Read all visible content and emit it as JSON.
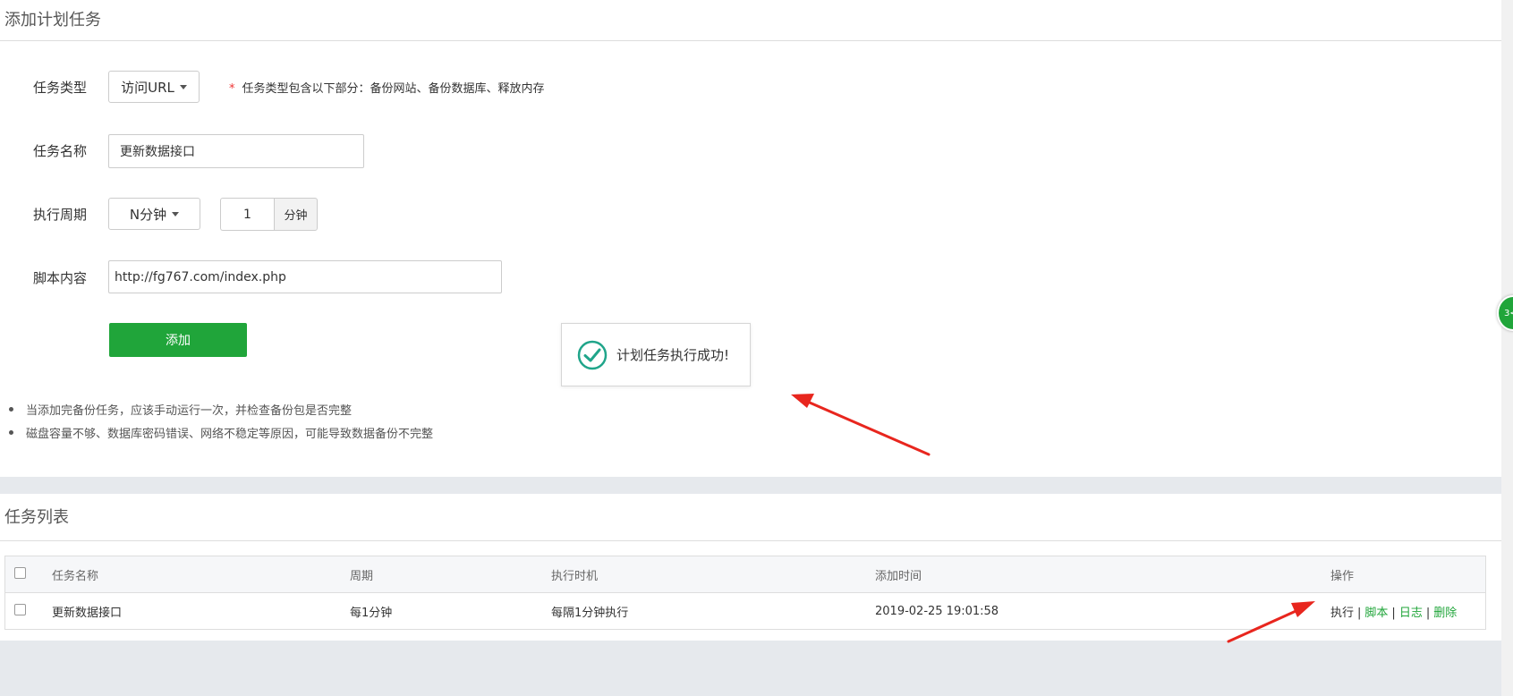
{
  "add_panel": {
    "title": "添加计划任务",
    "task_type_label": "任务类型",
    "task_type_value": "访问URL",
    "task_type_hint_star": "*",
    "task_type_hint": "任务类型包含以下部分：备份网站、备份数据库、释放内存",
    "task_name_label": "任务名称",
    "task_name_value": "更新数据接口",
    "cycle_label": "执行周期",
    "cycle_value": "N分钟",
    "cycle_number": "1",
    "cycle_unit": "分钟",
    "script_label": "脚本内容",
    "script_value": "http://fg767.com/index.php",
    "add_button": "添加",
    "notes": [
      "当添加完备份任务，应该手动运行一次，并检查备份包是否完整",
      "磁盘容量不够、数据库密码错误、网络不稳定等原因，可能导致数据备份不完整"
    ]
  },
  "toast": {
    "message": "计划任务执行成功!"
  },
  "side_tab": {
    "label": "3<"
  },
  "list_panel": {
    "title": "任务列表",
    "columns": [
      "任务名称",
      "周期",
      "执行时机",
      "添加时间",
      "操作"
    ],
    "rows": [
      {
        "name": "更新数据接口",
        "cycle": "每1分钟",
        "timing": "每隔1分钟执行",
        "added": "2019-02-25 19:01:58",
        "actions": {
          "exec": "执行",
          "script": "脚本",
          "log": "日志",
          "delete": "删除",
          "sep": "|"
        }
      }
    ]
  },
  "colors": {
    "accent": "#20a53a",
    "arrow": "#e8261e",
    "hint_star": "#e33333"
  },
  "icons": [
    "caret-down-icon",
    "check-circle-icon",
    "arrow-annotation"
  ]
}
